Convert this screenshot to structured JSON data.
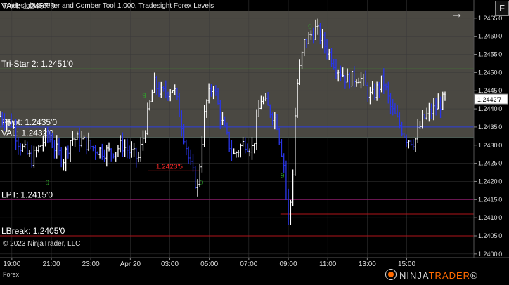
{
  "window": {
    "indicator_title": "Tradesight Seeker and Comber Tool 1.000, Tradesight Forex Levels",
    "panel_button": "F",
    "instrument": "Forex",
    "copyright": "© 2023 NinjaTrader, LLC",
    "brand_main": "NINJA",
    "brand_accent": "TRADER",
    "brand_suffix": "®"
  },
  "colors": {
    "background": "#000000",
    "value_area_fill": "#4a4842",
    "vah_line": "#5fd6cc",
    "tri_star_line": "#3e8a2e",
    "pivot_line": "#2f3fdd",
    "val_line": "#5fd6cc",
    "lpt_line": "#8a1d6a",
    "lbreak_line": "#b0141a",
    "midlevel_line": "#b0141a",
    "uptrend_bar": "#ffffff",
    "downtrend_bar": "#2a36e8",
    "signal_text": "#2fa62a",
    "price_marker_text": "#ff2a2a"
  },
  "chart_data": {
    "type": "candlestick",
    "y_axis": {
      "range": [
        1.2399,
        1.247
      ],
      "tick_labels": [
        "1.2465'0",
        "1.2460'0",
        "1.2455'0",
        "1.2450'0",
        "1.2445'0",
        "1.2440'0",
        "1.2435'0",
        "1.2430'0",
        "1.2425'0",
        "1.2420'0",
        "1.2415'0",
        "1.2410'0",
        "1.2405'0",
        "1.2400'0"
      ],
      "tick_values": [
        1.2465,
        1.246,
        1.2455,
        1.245,
        1.2445,
        1.244,
        1.2435,
        1.243,
        1.2425,
        1.242,
        1.2415,
        1.241,
        1.2405,
        1.24
      ],
      "current_price_label": "1.2442'7",
      "current_price": 1.24427
    },
    "x_axis": {
      "tick_labels": [
        "19:00",
        "21:00",
        "23:00",
        "Apr 20",
        "03:00",
        "05:00",
        "07:00",
        "09:00",
        "11:00",
        "13:00",
        "15:00"
      ],
      "tick_hours": [
        0,
        2,
        4,
        6,
        8,
        10,
        12,
        14,
        16,
        18,
        20
      ],
      "hours_span": [
        -0.6,
        23.4
      ]
    },
    "levels": [
      {
        "label": "VAH: 1.2467'0",
        "value": 1.2467,
        "color_key": "vah_line"
      },
      {
        "label": "Tri-Star 2: 1.2451'0",
        "value": 1.2451,
        "color_key": "tri_star_line"
      },
      {
        "label": "Pivot: 1.2435'0",
        "value": 1.2435,
        "color_key": "pivot_line"
      },
      {
        "label": "VAL: 1.2432'0",
        "value": 1.2432,
        "color_key": "val_line"
      },
      {
        "label": "LPT: 1.2415'0",
        "value": 1.2415,
        "color_key": "lpt_line"
      },
      {
        "label": "LBreak: 1.2405'0",
        "value": 1.2405,
        "color_key": "lbreak_line"
      }
    ],
    "price_marker": {
      "label": "1.2423'5",
      "value": 1.24235,
      "hour": 7.3
    },
    "midlevel": {
      "value": 1.2411,
      "from_hour": 13.6
    },
    "segments": [
      {
        "hour": -0.6,
        "price": 1.2438
      },
      {
        "hour": 0.0,
        "price": 1.2436
      },
      {
        "hour": 0.4,
        "price": 1.243
      },
      {
        "hour": 1.0,
        "price": 1.2426
      },
      {
        "hour": 1.8,
        "price": 1.2433
      },
      {
        "hour": 2.2,
        "price": 1.2429
      },
      {
        "hour": 2.6,
        "price": 1.2426
      },
      {
        "hour": 3.0,
        "price": 1.2432
      },
      {
        "hour": 3.6,
        "price": 1.2431
      },
      {
        "hour": 4.2,
        "price": 1.2429
      },
      {
        "hour": 5.0,
        "price": 1.2428
      },
      {
        "hour": 5.6,
        "price": 1.243
      },
      {
        "hour": 6.4,
        "price": 1.2426
      },
      {
        "hour": 6.8,
        "price": 1.2436
      },
      {
        "hour": 7.2,
        "price": 1.2447
      },
      {
        "hour": 7.6,
        "price": 1.2444
      },
      {
        "hour": 8.2,
        "price": 1.2446
      },
      {
        "hour": 8.6,
        "price": 1.2436
      },
      {
        "hour": 9.0,
        "price": 1.2425
      },
      {
        "hour": 9.4,
        "price": 1.2418
      },
      {
        "hour": 9.8,
        "price": 1.2441
      },
      {
        "hour": 10.2,
        "price": 1.2447
      },
      {
        "hour": 10.6,
        "price": 1.2437
      },
      {
        "hour": 11.2,
        "price": 1.2427
      },
      {
        "hour": 11.8,
        "price": 1.2431
      },
      {
        "hour": 12.2,
        "price": 1.2429
      },
      {
        "hour": 12.6,
        "price": 1.2443
      },
      {
        "hour": 13.0,
        "price": 1.244
      },
      {
        "hour": 13.4,
        "price": 1.2437
      },
      {
        "hour": 13.8,
        "price": 1.2424
      },
      {
        "hour": 14.0,
        "price": 1.2409
      },
      {
        "hour": 14.2,
        "price": 1.2418
      },
      {
        "hour": 14.4,
        "price": 1.2445
      },
      {
        "hour": 14.8,
        "price": 1.2458
      },
      {
        "hour": 15.4,
        "price": 1.2462
      },
      {
        "hour": 15.8,
        "price": 1.2458
      },
      {
        "hour": 16.4,
        "price": 1.2452
      },
      {
        "hour": 17.0,
        "price": 1.2448
      },
      {
        "hour": 17.6,
        "price": 1.2449
      },
      {
        "hour": 18.2,
        "price": 1.2443
      },
      {
        "hour": 18.8,
        "price": 1.2448
      },
      {
        "hour": 19.2,
        "price": 1.244
      },
      {
        "hour": 19.6,
        "price": 1.2436
      },
      {
        "hour": 20.0,
        "price": 1.2432
      },
      {
        "hour": 20.4,
        "price": 1.2431
      },
      {
        "hour": 20.8,
        "price": 1.2437
      },
      {
        "hour": 21.4,
        "price": 1.244
      },
      {
        "hour": 22.0,
        "price": 1.2443
      }
    ],
    "signal_counts": [
      {
        "text": "9",
        "hour": 1.7,
        "price": 1.2419
      },
      {
        "text": "9",
        "hour": 6.6,
        "price": 1.2443
      },
      {
        "text": "9",
        "hour": 9.5,
        "price": 1.2419
      },
      {
        "text": "9",
        "hour": 13.6,
        "price": 1.2421
      },
      {
        "text": "9",
        "hour": 15.0,
        "price": 1.2462
      }
    ]
  }
}
